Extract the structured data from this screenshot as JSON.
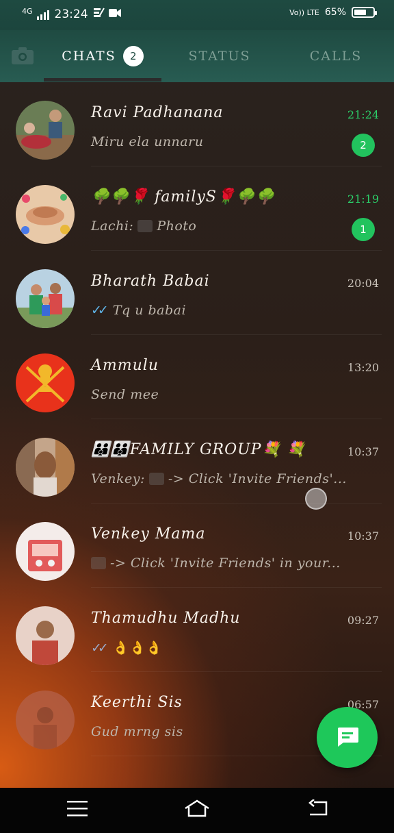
{
  "status_bar": {
    "network": "4G",
    "time": "23:24",
    "volte": "Vo)) LTE",
    "battery_text": "65%",
    "battery_level": 0.65
  },
  "tabs": [
    {
      "label": "CHATS",
      "badge": "2",
      "selected": true
    },
    {
      "label": "STATUS",
      "selected": false
    },
    {
      "label": "CALLS",
      "selected": false
    }
  ],
  "chats": [
    {
      "name": "Ravi Padhanana",
      "time": "21:24",
      "preview": "Miru ela unnaru",
      "unread": "2",
      "avatar_color": "#6a7d55"
    },
    {
      "name": "🌳🌳🌹 familyS🌹🌳🌳",
      "time": "21:19",
      "sender": "Lachi:",
      "preview": "Photo",
      "unread": "1",
      "avatar_color": "#d89a72"
    },
    {
      "name": "Bharath Babai",
      "time": "20:04",
      "preview": "Tq u babai",
      "ticks": "✓✓",
      "avatar_color": "#8fb0c5"
    },
    {
      "name": "Ammulu",
      "time": "13:20",
      "preview": "Send mee",
      "avatar_color": "#e8321b"
    },
    {
      "name": "👪👪FAMILY GROUP💐 💐",
      "time": "10:37",
      "sender": "Venkey:",
      "preview": "-> Click 'Invite Friends'...",
      "avatar_color": "#a07d62"
    },
    {
      "name": "Venkey Mama",
      "time": "10:37",
      "preview": "-> Click 'Invite Friends' in your...",
      "avatar_color": "#f2e3df"
    },
    {
      "name": "Thamudhu Madhu",
      "time": "09:27",
      "preview": "👌👌👌",
      "ticks": "✓✓",
      "avatar_color": "#c9a99a"
    },
    {
      "name": "Keerthi Sis",
      "time": "06:57",
      "preview": "Gud mrng sis",
      "avatar_color": "#b4614a"
    }
  ],
  "fab": {
    "icon": "new-chat-icon"
  },
  "nav": {
    "menu": "menu-icon",
    "home": "home-icon",
    "back": "back-icon"
  }
}
